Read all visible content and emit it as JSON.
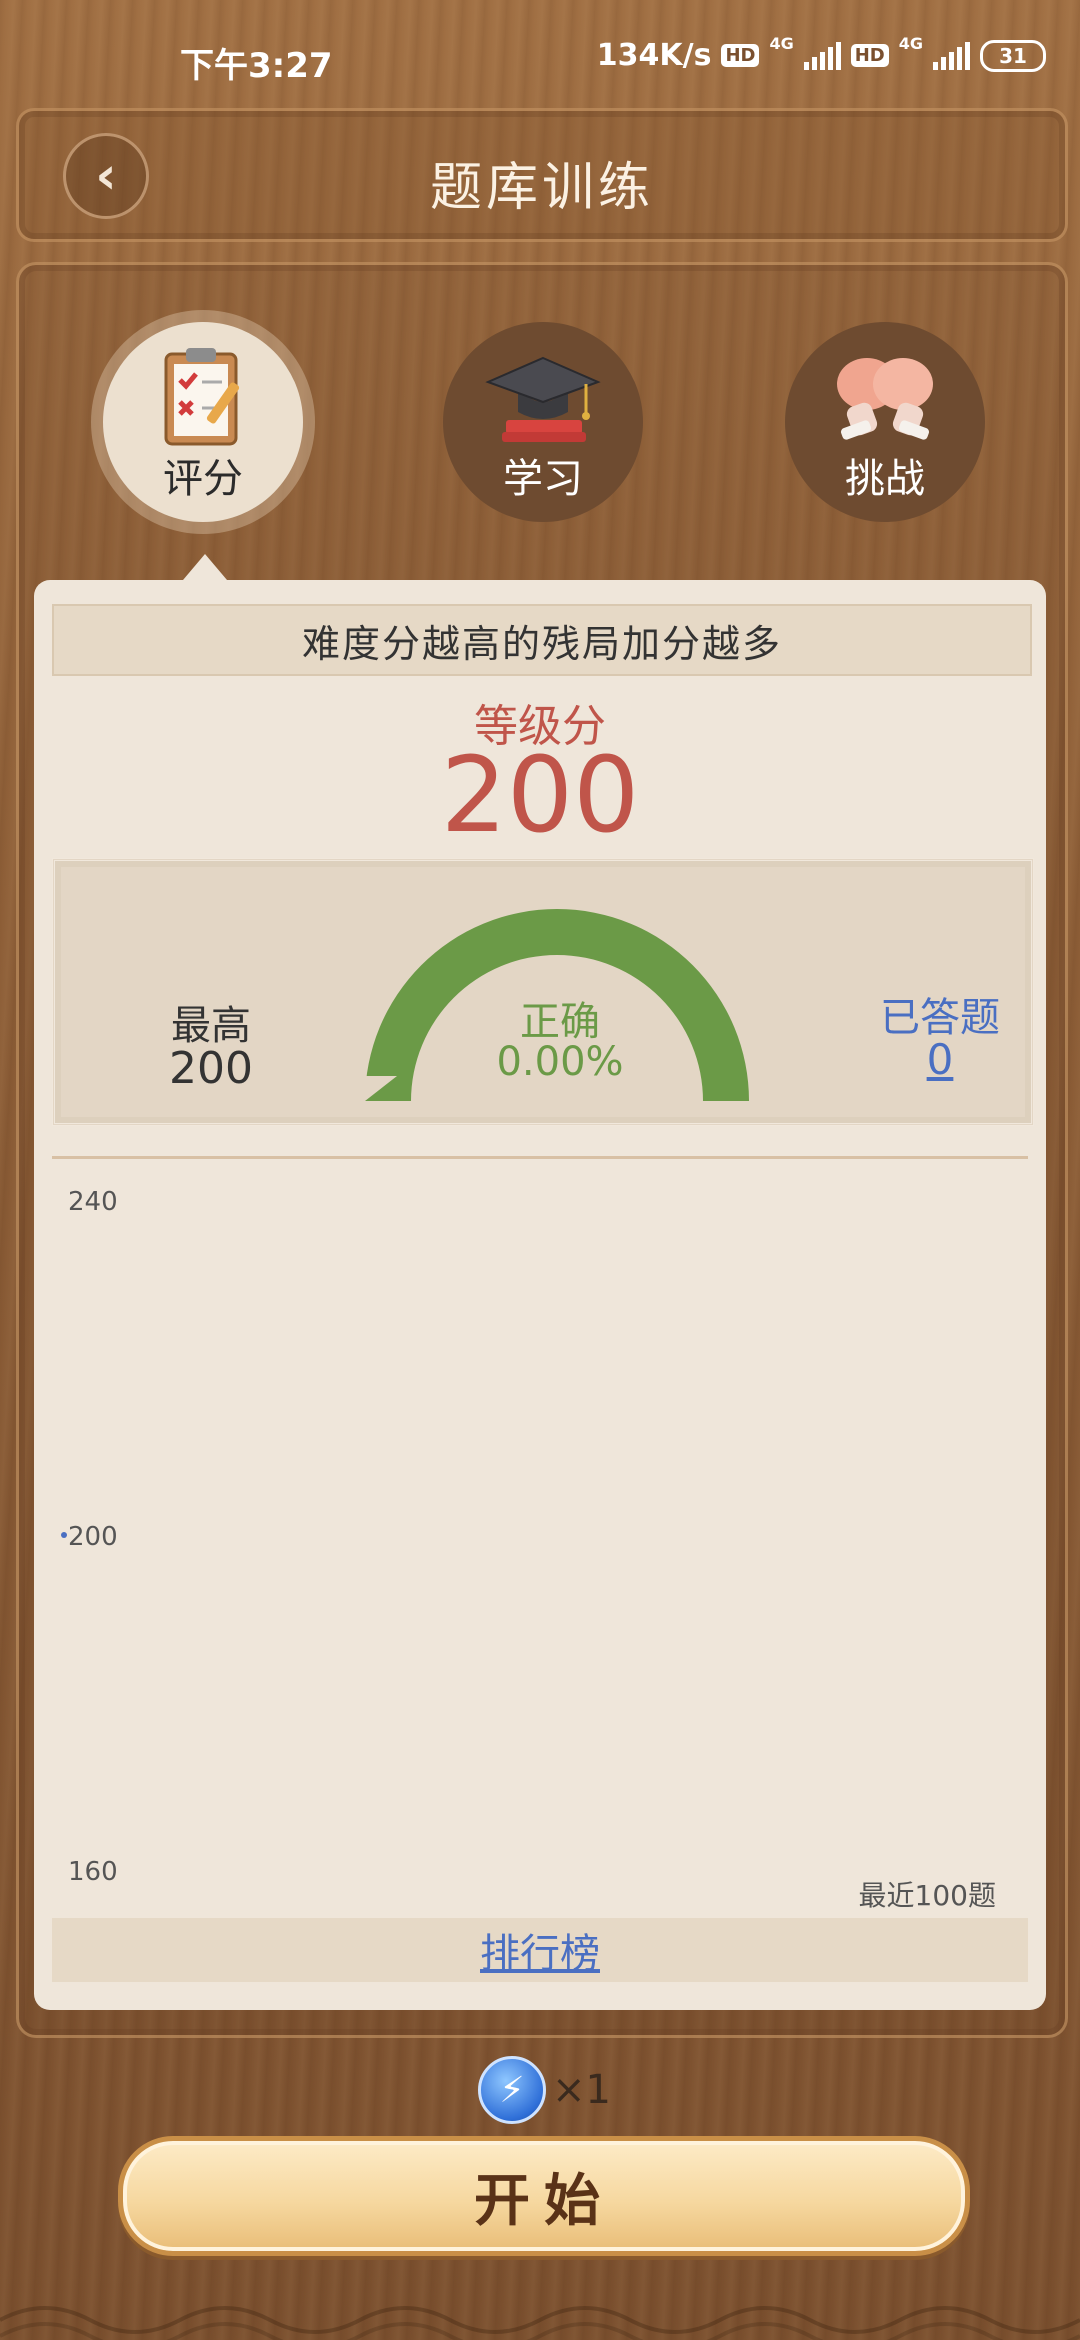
{
  "status": {
    "time": "下午3:27",
    "speed": "134K/s",
    "hd1": "HD",
    "net1": "4G",
    "hd2": "HD",
    "net2": "4G",
    "battery": "31"
  },
  "header": {
    "title": "题库训练",
    "back_icon": "chevron-left-icon"
  },
  "tabs": [
    {
      "label": "评分",
      "icon": "clipboard-icon",
      "active": true
    },
    {
      "label": "学习",
      "icon": "graduation-cap-icon",
      "active": false
    },
    {
      "label": "挑战",
      "icon": "arm-wrestle-icon",
      "active": false
    }
  ],
  "card": {
    "hint": "难度分越高的残局加分越多",
    "level_label": "等级分",
    "level_value": "200",
    "best_label": "最高",
    "best_value": "200",
    "correct_label": "正确",
    "correct_value": "0.00%",
    "answered_label": "已答题",
    "answered_value": "0",
    "rank_label": "排行榜"
  },
  "colors": {
    "accent_red": "#c0554a",
    "gauge_green": "#6b9a47",
    "link_blue": "#4a6fc2"
  },
  "chart_data": {
    "type": "line",
    "y_ticks": [
      "240",
      "200",
      "160"
    ],
    "ylim": [
      160,
      240
    ],
    "x": [
      1
    ],
    "values": [
      200
    ],
    "note": "最近100题"
  },
  "footer": {
    "energy_icon": "lightning-icon",
    "energy_count": "×1",
    "start_label": "开始"
  }
}
